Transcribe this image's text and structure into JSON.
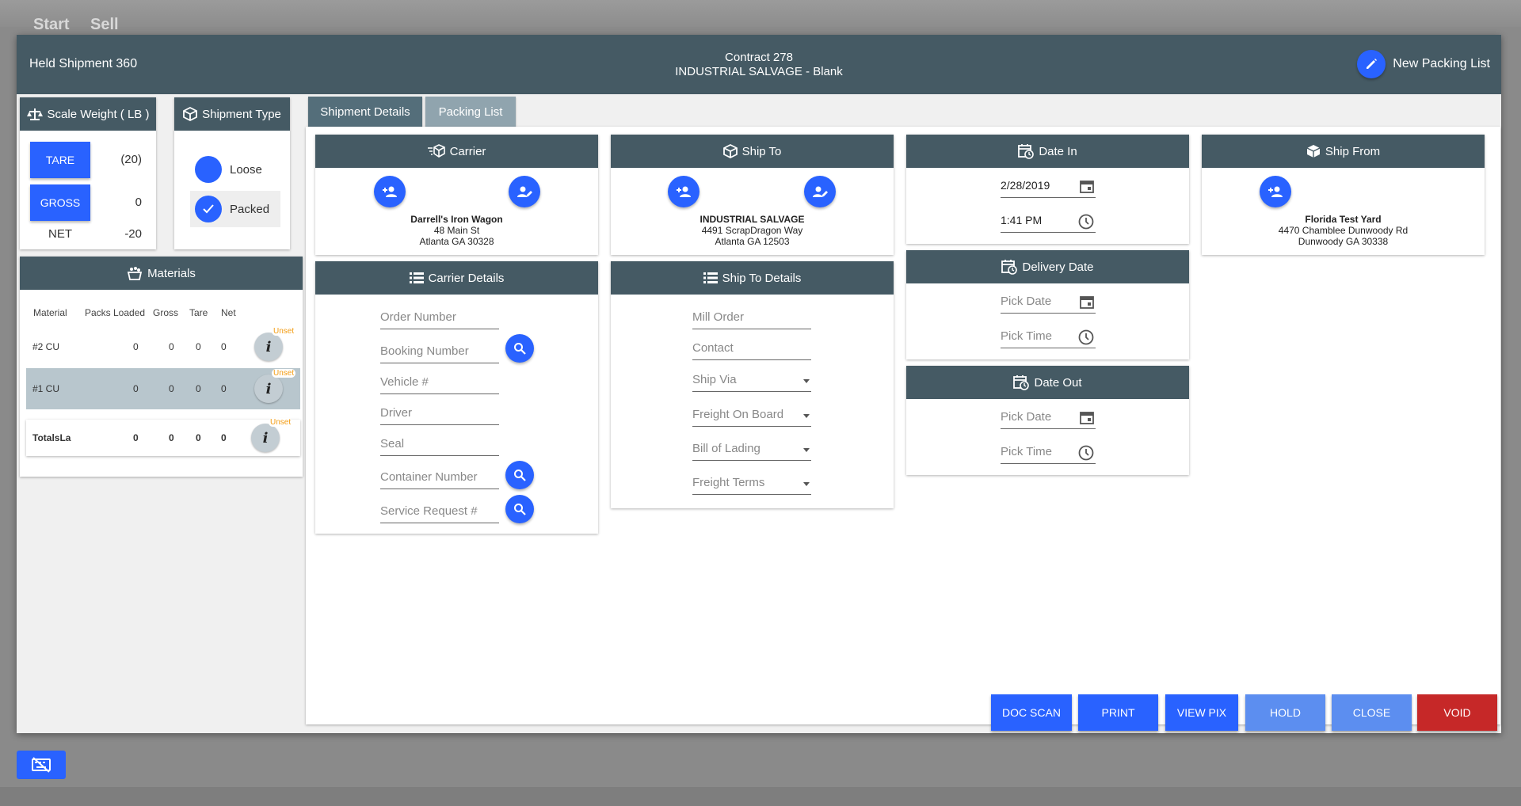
{
  "background": {
    "menu": [
      "Start",
      "Sell"
    ]
  },
  "header": {
    "title": "Held Shipment 360",
    "contract": "Contract 278",
    "customer": "INDUSTRIAL SALVAGE - Blank",
    "new_packing_list": "New Packing List"
  },
  "scale_weight": {
    "title": "Scale Weight ( LB )",
    "tare_label": "TARE",
    "tare_value": "(20)",
    "gross_label": "GROSS",
    "gross_value": "0",
    "net_label": "NET",
    "net_value": "-20"
  },
  "shipment_type": {
    "title": "Shipment Type",
    "options": [
      {
        "label": "Loose",
        "selected": false
      },
      {
        "label": "Packed",
        "selected": true
      }
    ]
  },
  "materials": {
    "title": "Materials",
    "columns": [
      "Material",
      "Packs Loaded",
      "Gross",
      "Tare",
      "Net"
    ],
    "rows": [
      {
        "material": "#2 CU",
        "packs": "0",
        "gross": "0",
        "tare": "0",
        "net": "0",
        "badge": "Unset",
        "selected": false
      },
      {
        "material": "#1 CU",
        "packs": "0",
        "gross": "0",
        "tare": "0",
        "net": "0",
        "badge": "Unset",
        "selected": true
      }
    ],
    "totals": {
      "material": "TotalsLa",
      "packs": "0",
      "gross": "0",
      "tare": "0",
      "net": "0",
      "badge": "Unset"
    }
  },
  "tabs": [
    {
      "label": "Shipment Details",
      "active": true
    },
    {
      "label": "Packing List",
      "active": false
    }
  ],
  "carrier": {
    "title": "Carrier",
    "name": "Darrell's Iron Wagon",
    "address1": "48 Main St",
    "address2": "Atlanta GA 30328"
  },
  "ship_to": {
    "title": "Ship To",
    "name": "INDUSTRIAL SALVAGE",
    "address1": "4491 ScrapDragon Way",
    "address2": "Atlanta GA 12503"
  },
  "date_in": {
    "title": "Date In",
    "date": "2/28/2019",
    "time": "1:41 PM"
  },
  "ship_from": {
    "title": "Ship From",
    "name": "Florida Test Yard",
    "address1": "4470 Chamblee Dunwoody Rd",
    "address2": "Dunwoody GA 30338"
  },
  "carrier_details": {
    "title": "Carrier Details",
    "fields": [
      "Order Number",
      "Booking Number",
      "Vehicle #",
      "Driver",
      "Seal",
      "Container Number",
      "Service Request #"
    ]
  },
  "ship_to_details": {
    "title": "Ship To Details",
    "fields": [
      "Mill Order",
      "Contact",
      "Ship Via",
      "Freight On Board",
      "Bill of Lading",
      "Freight Terms"
    ]
  },
  "delivery_date": {
    "title": "Delivery Date",
    "date_placeholder": "Pick Date",
    "time_placeholder": "Pick Time"
  },
  "date_out": {
    "title": "Date Out",
    "date_placeholder": "Pick Date",
    "time_placeholder": "Pick Time"
  },
  "footer": {
    "doc_scan": "DOC SCAN",
    "print": "PRINT",
    "view_pix": "VIEW PIX",
    "hold": "HOLD",
    "close": "CLOSE",
    "void": "VOID"
  },
  "colors": {
    "header": "#455a64",
    "primary": "#2962ff",
    "muted_button": "#5c8ef0",
    "void": "#c62828",
    "badge": "#f39c12"
  }
}
